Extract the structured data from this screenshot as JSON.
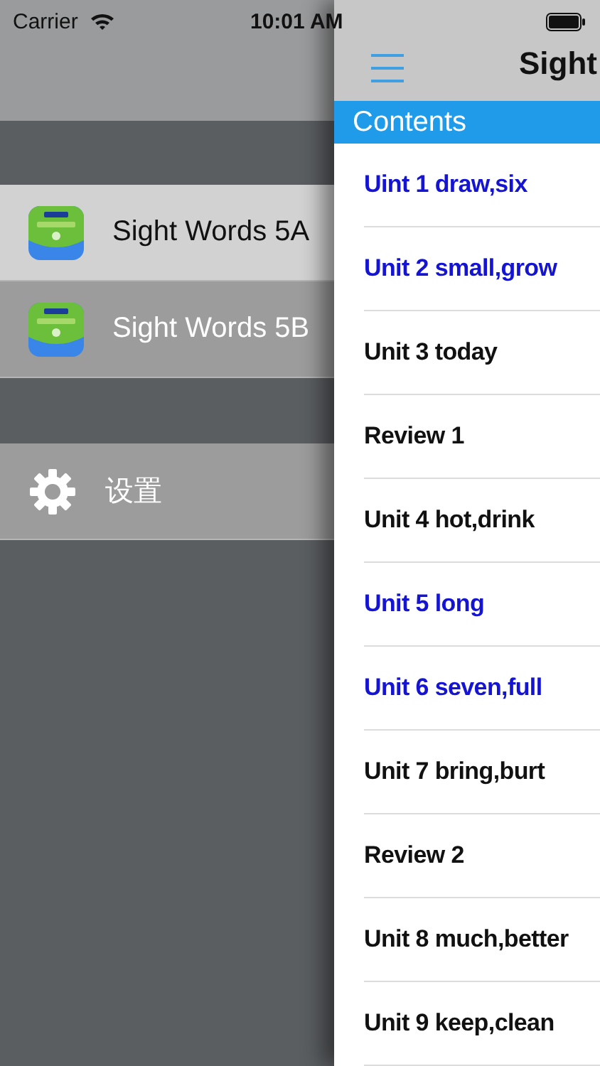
{
  "status_bar": {
    "carrier": "Carrier",
    "time": "10:01 AM"
  },
  "side_menu": {
    "books": [
      {
        "title": "Sight Words 5A",
        "selected": true
      },
      {
        "title": "Sight Words 5B",
        "selected": false
      }
    ],
    "settings": {
      "label": "设置"
    }
  },
  "panel": {
    "title": "Sight",
    "section": "Contents",
    "lessons": [
      {
        "title": "Uint 1 draw,six",
        "completed": true
      },
      {
        "title": "Unit 2 small,grow",
        "completed": true
      },
      {
        "title": "Unit 3 today",
        "completed": false
      },
      {
        "title": "Review 1",
        "completed": false
      },
      {
        "title": "Unit 4 hot,drink",
        "completed": false
      },
      {
        "title": "Unit 5 long",
        "completed": true
      },
      {
        "title": "Unit 6 seven,full",
        "completed": true
      },
      {
        "title": "Unit 7 bring,burt",
        "completed": false
      },
      {
        "title": "Review 2",
        "completed": false
      },
      {
        "title": "Unit 8 much,better",
        "completed": false
      },
      {
        "title": "Unit 9 keep,clean",
        "completed": false
      }
    ]
  }
}
